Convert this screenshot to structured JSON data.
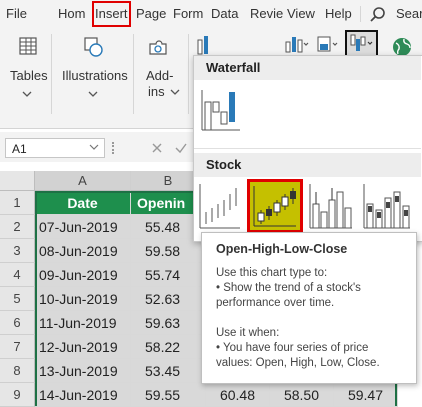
{
  "menu": {
    "items": [
      "File",
      "Hom",
      "Insert",
      "Page",
      "Form",
      "Data",
      "Revie",
      "View",
      "Help"
    ],
    "search_label": "Sear"
  },
  "ribbon": {
    "tables_label": "Tables",
    "illustrations_label": "Illustrations",
    "addins_label_1": "Add-",
    "addins_label_2": "ins"
  },
  "formula_bar": {
    "name_box": "A1"
  },
  "sheet": {
    "columns": [
      "A",
      "B"
    ],
    "header_row": [
      "Date",
      "Openin",
      "",
      "",
      ""
    ],
    "rows": [
      {
        "num": "1"
      },
      {
        "num": "2",
        "cells": [
          "07-Jun-2019",
          "55.48"
        ]
      },
      {
        "num": "3",
        "cells": [
          "08-Jun-2019",
          "59.58"
        ]
      },
      {
        "num": "4",
        "cells": [
          "09-Jun-2019",
          "55.74"
        ]
      },
      {
        "num": "5",
        "cells": [
          "10-Jun-2019",
          "52.63"
        ]
      },
      {
        "num": "6",
        "cells": [
          "11-Jun-2019",
          "59.63"
        ]
      },
      {
        "num": "7",
        "cells": [
          "12-Jun-2019",
          "58.22"
        ]
      },
      {
        "num": "8",
        "cells": [
          "13-Jun-2019",
          "53.45"
        ]
      },
      {
        "num": "9",
        "cells": [
          "14-Jun-2019",
          "59.55",
          "60.48",
          "58.50",
          "59.47"
        ]
      }
    ]
  },
  "chart_menu": {
    "waterfall_heading": "Waterfall",
    "stock_heading": "Stock"
  },
  "tooltip": {
    "title": "Open-High-Low-Close",
    "lines": [
      "Use this chart type to:",
      "• Show the trend of a stock's",
      "performance over time.",
      "",
      "Use it when:",
      "• You have four series of price",
      "values: Open, High, Low, Close."
    ]
  },
  "colors": {
    "header_green": "#1e8f4d",
    "highlight_red": "#e00000",
    "selected_chart_bg": "#c5c000"
  }
}
